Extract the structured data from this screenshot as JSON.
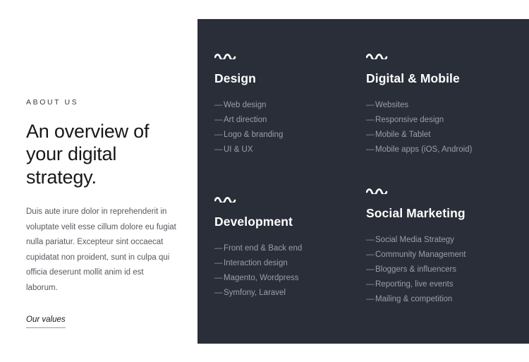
{
  "theme": {
    "page_background": "#ffffff",
    "panel_background": "#2a2e38",
    "heading_color": "#17181a",
    "body_color": "#55585e",
    "panel_title_color": "#ffffff",
    "panel_item_color": "#9a9ea8",
    "ornament_color": "#ffffff"
  },
  "intro": {
    "eyebrow": "ABOUT US",
    "headline": "An overview of your digital strategy.",
    "paragraph": "Duis aute irure dolor in reprehenderit in voluptate velit esse cillum dolore eu fugiat nulla pariatur. Excepteur sint occaecat cupidatat non proident, sunt in culpa qui officia deserunt mollit anim id est laborum.",
    "link_label": "Our values"
  },
  "services": {
    "item_bullet": "—",
    "blocks": [
      {
        "ornament": "wavy-line-icon",
        "title": "Design",
        "items": [
          "Web design",
          "Art direction",
          "Logo & branding",
          "UI & UX"
        ]
      },
      {
        "ornament": "wavy-line-icon",
        "title": "Digital & Mobile",
        "items": [
          "Websites",
          "Responsive design",
          "Mobile & Tablet",
          "Mobile apps (iOS, Android)"
        ]
      },
      {
        "ornament": "wavy-line-icon",
        "title": "Development",
        "items": [
          "Front end & Back end",
          "Interaction design",
          "Magento, Wordpress",
          "Symfony, Laravel"
        ]
      },
      {
        "ornament": "wavy-line-icon",
        "title": "Social Marketing",
        "items": [
          "Social Media Strategy",
          "Community Management",
          "Bloggers & influencers",
          "Reporting, live events",
          "Mailing & competition"
        ]
      }
    ]
  }
}
